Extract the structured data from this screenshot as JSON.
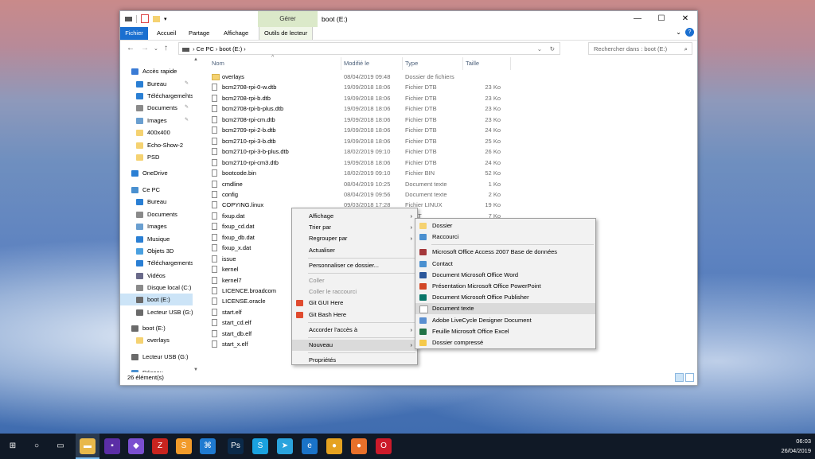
{
  "window": {
    "title": "boot (E:)",
    "manage_tab": "Gérer",
    "controls": {
      "minimize": "—",
      "maximize": "☐",
      "close": "✕"
    }
  },
  "ribbon": {
    "tabs": [
      "Fichier",
      "Accueil",
      "Partage",
      "Affichage",
      "Outils de lecteur"
    ]
  },
  "address": {
    "path": "›  Ce PC  ›  boot (E:)  ›",
    "search_placeholder": "Rechercher dans : boot (E:)"
  },
  "sidebar": {
    "items": [
      {
        "label": "Accès rapide",
        "icon": "star-icon",
        "color": "#3a7bd5"
      },
      {
        "label": "Bureau",
        "icon": "desktop-icon",
        "color": "#2a7fd4"
      },
      {
        "label": "Téléchargements",
        "icon": "download-icon",
        "color": "#2a7fd4"
      },
      {
        "label": "Documents",
        "icon": "documents-icon",
        "color": "#8a8a8a"
      },
      {
        "label": "Images",
        "icon": "images-icon",
        "color": "#6a9fd0"
      },
      {
        "label": "400x400",
        "icon": "folder-icon",
        "color": "#f5d271"
      },
      {
        "label": "Echo-Show-2",
        "icon": "folder-icon",
        "color": "#f5d271"
      },
      {
        "label": "PSD",
        "icon": "folder-icon",
        "color": "#f5d271"
      },
      {
        "label": "OneDrive",
        "icon": "cloud-icon",
        "color": "#2a7fd4"
      },
      {
        "label": "Ce PC",
        "icon": "computer-icon",
        "color": "#4a90d0"
      },
      {
        "label": "Bureau",
        "icon": "desktop-icon",
        "color": "#2a7fd4"
      },
      {
        "label": "Documents",
        "icon": "documents-icon",
        "color": "#8a8a8a"
      },
      {
        "label": "Images",
        "icon": "images-icon",
        "color": "#6a9fd0"
      },
      {
        "label": "Musique",
        "icon": "music-icon",
        "color": "#2a7fd4"
      },
      {
        "label": "Objets 3D",
        "icon": "cube-icon",
        "color": "#4aa0e0"
      },
      {
        "label": "Téléchargements",
        "icon": "download-icon",
        "color": "#2a7fd4"
      },
      {
        "label": "Vidéos",
        "icon": "video-icon",
        "color": "#6a6a8a"
      },
      {
        "label": "Disque local (C:)",
        "icon": "drive-icon",
        "color": "#8a8a8a"
      },
      {
        "label": "boot (E:)",
        "icon": "drive-icon",
        "color": "#6a6a6a"
      },
      {
        "label": "Lecteur USB (G:)",
        "icon": "usb-drive-icon",
        "color": "#6a6a6a"
      },
      {
        "label": "boot (E:)",
        "icon": "drive-icon",
        "color": "#6a6a6a"
      },
      {
        "label": "overlays",
        "icon": "folder-icon",
        "color": "#f5d271"
      },
      {
        "label": "Lecteur USB (G:)",
        "icon": "usb-drive-icon",
        "color": "#6a6a6a"
      },
      {
        "label": "Réseau",
        "icon": "network-icon",
        "color": "#4a90d0"
      }
    ]
  },
  "columns": {
    "name": "Nom",
    "modified": "Modifié le",
    "type": "Type",
    "size": "Taille"
  },
  "files": [
    {
      "name": "overlays",
      "date": "08/04/2019 09:48",
      "type": "Dossier de fichiers",
      "size": "",
      "folder": true
    },
    {
      "name": "bcm2708-rpi-0-w.dtb",
      "date": "19/09/2018 18:06",
      "type": "Fichier DTB",
      "size": "23 Ko"
    },
    {
      "name": "bcm2708-rpi-b.dtb",
      "date": "19/09/2018 18:06",
      "type": "Fichier DTB",
      "size": "23 Ko"
    },
    {
      "name": "bcm2708-rpi-b-plus.dtb",
      "date": "19/09/2018 18:06",
      "type": "Fichier DTB",
      "size": "23 Ko"
    },
    {
      "name": "bcm2708-rpi-cm.dtb",
      "date": "19/09/2018 18:06",
      "type": "Fichier DTB",
      "size": "23 Ko"
    },
    {
      "name": "bcm2709-rpi-2-b.dtb",
      "date": "19/09/2018 18:06",
      "type": "Fichier DTB",
      "size": "24 Ko"
    },
    {
      "name": "bcm2710-rpi-3-b.dtb",
      "date": "19/09/2018 18:06",
      "type": "Fichier DTB",
      "size": "25 Ko"
    },
    {
      "name": "bcm2710-rpi-3-b-plus.dtb",
      "date": "18/02/2019 09:10",
      "type": "Fichier DTB",
      "size": "26 Ko"
    },
    {
      "name": "bcm2710-rpi-cm3.dtb",
      "date": "19/09/2018 18:06",
      "type": "Fichier DTB",
      "size": "24 Ko"
    },
    {
      "name": "bootcode.bin",
      "date": "18/02/2019 09:10",
      "type": "Fichier BIN",
      "size": "52 Ko"
    },
    {
      "name": "cmdline",
      "date": "08/04/2019 10:25",
      "type": "Document texte",
      "size": "1 Ko"
    },
    {
      "name": "config",
      "date": "08/04/2019 09:56",
      "type": "Document texte",
      "size": "2 Ko"
    },
    {
      "name": "COPYING.linux",
      "date": "09/03/2018 17:28",
      "type": "Fichier LINUX",
      "size": "19 Ko"
    },
    {
      "name": "fixup.dat",
      "date": "",
      "type": "...DAT",
      "size": "7 Ko"
    },
    {
      "name": "fixup_cd.dat",
      "date": "",
      "type": "",
      "size": ""
    },
    {
      "name": "fixup_db.dat",
      "date": "",
      "type": "",
      "size": ""
    },
    {
      "name": "fixup_x.dat",
      "date": "",
      "type": "",
      "size": ""
    },
    {
      "name": "issue",
      "date": "",
      "type": "",
      "size": ""
    },
    {
      "name": "kernel",
      "date": "",
      "type": "",
      "size": ""
    },
    {
      "name": "kernel7",
      "date": "",
      "type": "",
      "size": ""
    },
    {
      "name": "LICENCE.broadcom",
      "date": "",
      "type": "",
      "size": ""
    },
    {
      "name": "LICENSE.oracle",
      "date": "",
      "type": "",
      "size": ""
    },
    {
      "name": "start.elf",
      "date": "",
      "type": "",
      "size": ""
    },
    {
      "name": "start_cd.elf",
      "date": "",
      "type": "",
      "size": ""
    },
    {
      "name": "start_db.elf",
      "date": "",
      "type": "",
      "size": ""
    },
    {
      "name": "start_x.elf",
      "date": "",
      "type": "",
      "size": ""
    }
  ],
  "status": {
    "count": "26 élément(s)"
  },
  "context_menu": {
    "items": [
      {
        "label": "Affichage",
        "submenu": true
      },
      {
        "label": "Trier par",
        "submenu": true
      },
      {
        "label": "Regrouper par",
        "submenu": true
      },
      {
        "label": "Actualiser"
      },
      {
        "sep": true
      },
      {
        "label": "Personnaliser ce dossier..."
      },
      {
        "sep": true
      },
      {
        "label": "Coller",
        "disabled": true
      },
      {
        "label": "Coller le raccourci",
        "disabled": true
      },
      {
        "label": "Git GUI Here",
        "icon": "git-gui-icon",
        "color": "#e04b2f"
      },
      {
        "label": "Git Bash Here",
        "icon": "git-bash-icon",
        "color": "#e04b2f"
      },
      {
        "sep": true
      },
      {
        "label": "Accorder l'accès à",
        "submenu": true
      },
      {
        "sep": true
      },
      {
        "label": "Nouveau",
        "submenu": true,
        "highlight": true
      },
      {
        "sep": true
      },
      {
        "label": "Propriétés"
      }
    ]
  },
  "submenu_new": {
    "items": [
      {
        "label": "Dossier",
        "icon": "folder-icon",
        "color": "#f5d271"
      },
      {
        "label": "Raccourci",
        "icon": "shortcut-icon",
        "color": "#4a90d0"
      },
      {
        "sep": true
      },
      {
        "label": "Microsoft Office Access 2007 Base de données",
        "icon": "access-icon",
        "color": "#a4373a"
      },
      {
        "label": "Contact",
        "icon": "contact-icon",
        "color": "#4a90d0"
      },
      {
        "label": "Document Microsoft Office Word",
        "icon": "word-icon",
        "color": "#2b579a"
      },
      {
        "label": "Présentation Microsoft Office PowerPoint",
        "icon": "powerpoint-icon",
        "color": "#d24726"
      },
      {
        "label": "Document Microsoft Office Publisher",
        "icon": "publisher-icon",
        "color": "#077568"
      },
      {
        "label": "Document texte",
        "icon": "text-doc-icon",
        "color": "#ffffff",
        "highlight": true
      },
      {
        "label": "Adobe LiveCycle Designer Document",
        "icon": "adobe-icon",
        "color": "#5a8fd0"
      },
      {
        "label": "Feuille Microsoft Office Excel",
        "icon": "excel-icon",
        "color": "#217346"
      },
      {
        "label": "Dossier compressé",
        "icon": "zip-folder-icon",
        "color": "#f5c94a"
      }
    ]
  },
  "taskbar": {
    "icons": [
      {
        "name": "start-icon",
        "glyph": "⊞",
        "bg": "transparent"
      },
      {
        "name": "cortana-icon",
        "glyph": "○",
        "bg": "transparent"
      },
      {
        "name": "task-view-icon",
        "glyph": "▭",
        "bg": "transparent"
      },
      {
        "name": "file-explorer-icon",
        "glyph": "▬",
        "bg": "#e8b84a"
      },
      {
        "name": "teams-app-icon",
        "glyph": "▪",
        "bg": "#5b2ea6"
      },
      {
        "name": "tor-app-icon",
        "glyph": "◆",
        "bg": "#7a4fd0"
      },
      {
        "name": "filezilla-icon",
        "glyph": "Z",
        "bg": "#c8241f"
      },
      {
        "name": "sublime-icon",
        "glyph": "S",
        "bg": "#f29b2a"
      },
      {
        "name": "vscode-icon",
        "glyph": "⌘",
        "bg": "#1f7ad0"
      },
      {
        "name": "photoshop-icon",
        "glyph": "Ps",
        "bg": "#0b2a4a"
      },
      {
        "name": "skype-icon",
        "glyph": "S",
        "bg": "#1aa2e0"
      },
      {
        "name": "telegram-icon",
        "glyph": "➤",
        "bg": "#2aa3dd"
      },
      {
        "name": "edge-icon",
        "glyph": "e",
        "bg": "#1a73c8"
      },
      {
        "name": "chrome-icon",
        "glyph": "●",
        "bg": "#e5a220"
      },
      {
        "name": "firefox-icon",
        "glyph": "●",
        "bg": "#e8702a"
      },
      {
        "name": "opera-icon",
        "glyph": "O",
        "bg": "#cc1a2a"
      }
    ],
    "time": "06:03",
    "date": "26/04/2019"
  }
}
